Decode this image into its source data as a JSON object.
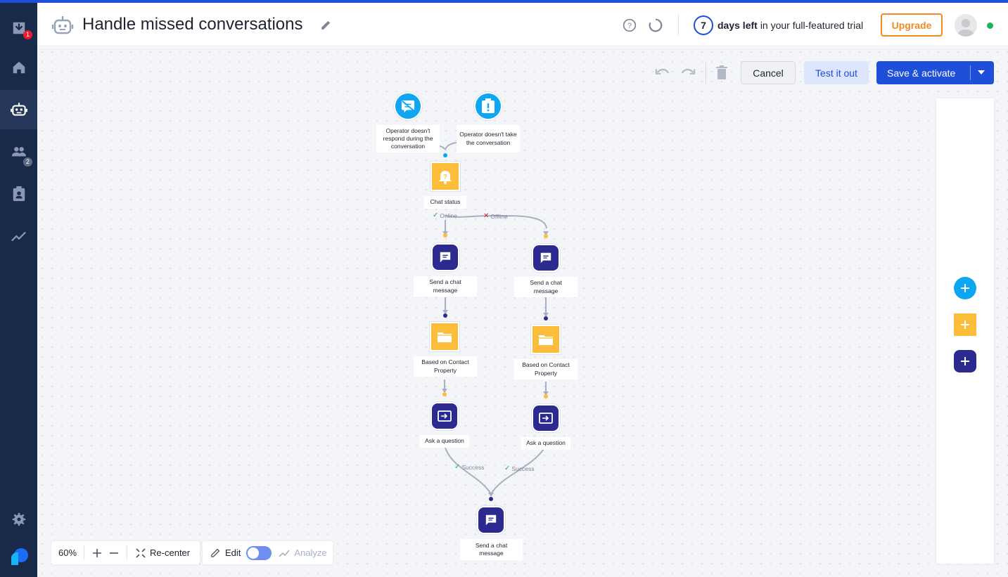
{
  "header": {
    "title": "Handle missed conversations",
    "trial_days": "7",
    "trial_bold": "days left",
    "trial_rest": "in your full-featured trial",
    "upgrade_label": "Upgrade"
  },
  "sidebar": {
    "items": [
      {
        "icon": "inbox-icon",
        "badge": "1"
      },
      {
        "icon": "home-icon"
      },
      {
        "icon": "bot-icon",
        "active": true
      },
      {
        "icon": "contacts-icon",
        "badge": "2"
      },
      {
        "icon": "contact-card-icon"
      },
      {
        "icon": "analytics-icon"
      },
      {
        "icon": "settings-icon"
      },
      {
        "icon": "brand-logo-icon"
      }
    ]
  },
  "toolbar": {
    "cancel_label": "Cancel",
    "test_label": "Test it out",
    "save_label": "Save & activate"
  },
  "flow": {
    "trigger1": "Operator doesn't respond during the conversation",
    "trigger2": "Operator doesn't take the conversation",
    "chat_status": "Chat status",
    "online": "Online",
    "offline": "Offline",
    "send_left": "Send a chat message",
    "send_right": "Send a chat message",
    "contact_left": "Based on Contact Property",
    "contact_right": "Based on Contact Property",
    "ask_left": "Ask a question",
    "ask_right": "Ask a question",
    "success_left": "Success",
    "success_right": "Success",
    "send_final": "Send a chat message"
  },
  "bottom": {
    "zoom": "60%",
    "recenter_label": "Re-center",
    "edit_label": "Edit",
    "analyze_label": "Analyze",
    "edit_mode": true
  },
  "colors": {
    "brand_blue": "#1d4fd8",
    "upgrade_orange": "#f28a1c",
    "trigger_blue": "#0ea5f2",
    "condition_yellow": "#fbbd3a",
    "action_purple": "#2d2a8f"
  }
}
